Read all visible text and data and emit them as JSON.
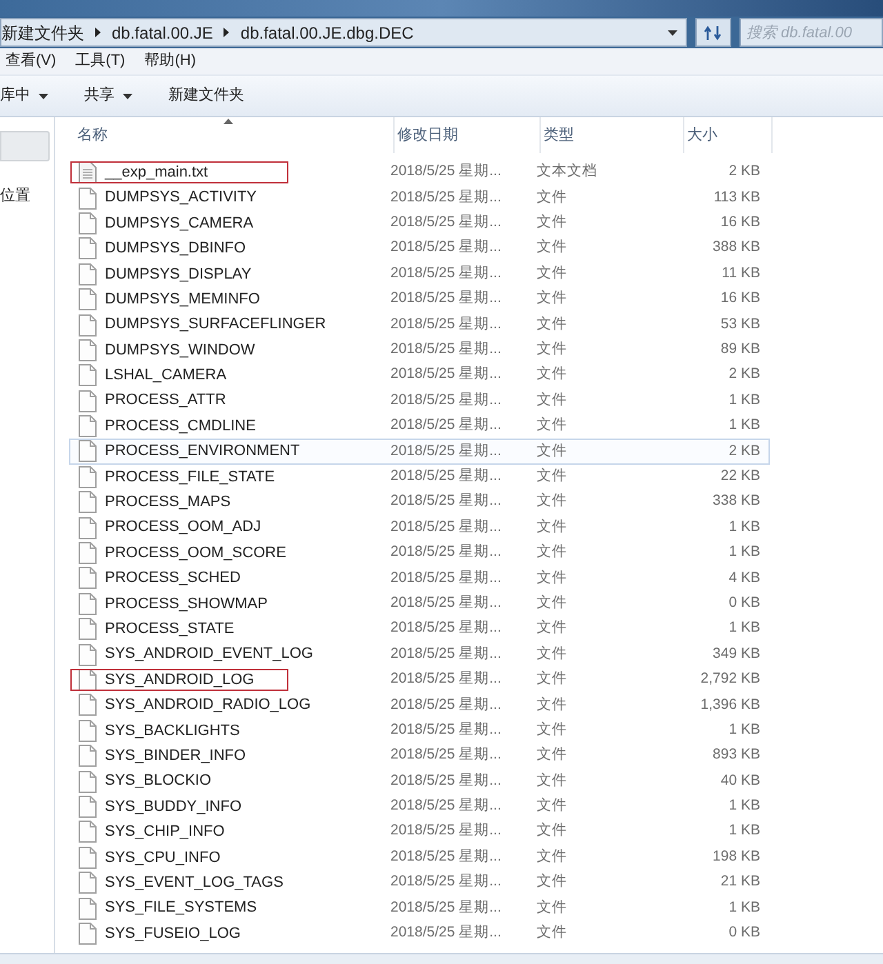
{
  "address_bar": {
    "crumbs": [
      "新建文件夹",
      "db.fatal.00.JE",
      "db.fatal.00.JE.dbg.DEC"
    ]
  },
  "search": {
    "placeholder": "搜索 db.fatal.00"
  },
  "menu": [
    "查看(V)",
    "工具(T)",
    "帮助(H)"
  ],
  "toolbar": [
    {
      "label": "库中",
      "dropdown": true
    },
    {
      "label": "共享",
      "dropdown": true
    },
    {
      "label": "新建文件夹",
      "dropdown": false
    }
  ],
  "nav_pane": {
    "items": [
      "位置"
    ]
  },
  "table": {
    "columns": [
      "名称",
      "修改日期",
      "类型",
      "大小"
    ],
    "rows": [
      {
        "name": "__exp_main.txt",
        "date": "2018/5/25 星期...",
        "type": "文本文档",
        "size": "2 KB",
        "kind": "text",
        "highlighted": true,
        "hovered": false
      },
      {
        "name": "DUMPSYS_ACTIVITY",
        "date": "2018/5/25 星期...",
        "type": "文件",
        "size": "113 KB",
        "kind": "file",
        "highlighted": false,
        "hovered": false
      },
      {
        "name": "DUMPSYS_CAMERA",
        "date": "2018/5/25 星期...",
        "type": "文件",
        "size": "16 KB",
        "kind": "file",
        "highlighted": false,
        "hovered": false
      },
      {
        "name": "DUMPSYS_DBINFO",
        "date": "2018/5/25 星期...",
        "type": "文件",
        "size": "388 KB",
        "kind": "file",
        "highlighted": false,
        "hovered": false
      },
      {
        "name": "DUMPSYS_DISPLAY",
        "date": "2018/5/25 星期...",
        "type": "文件",
        "size": "11 KB",
        "kind": "file",
        "highlighted": false,
        "hovered": false
      },
      {
        "name": "DUMPSYS_MEMINFO",
        "date": "2018/5/25 星期...",
        "type": "文件",
        "size": "16 KB",
        "kind": "file",
        "highlighted": false,
        "hovered": false
      },
      {
        "name": "DUMPSYS_SURFACEFLINGER",
        "date": "2018/5/25 星期...",
        "type": "文件",
        "size": "53 KB",
        "kind": "file",
        "highlighted": false,
        "hovered": false
      },
      {
        "name": "DUMPSYS_WINDOW",
        "date": "2018/5/25 星期...",
        "type": "文件",
        "size": "89 KB",
        "kind": "file",
        "highlighted": false,
        "hovered": false
      },
      {
        "name": "LSHAL_CAMERA",
        "date": "2018/5/25 星期...",
        "type": "文件",
        "size": "2 KB",
        "kind": "file",
        "highlighted": false,
        "hovered": false
      },
      {
        "name": "PROCESS_ATTR",
        "date": "2018/5/25 星期...",
        "type": "文件",
        "size": "1 KB",
        "kind": "file",
        "highlighted": false,
        "hovered": false
      },
      {
        "name": "PROCESS_CMDLINE",
        "date": "2018/5/25 星期...",
        "type": "文件",
        "size": "1 KB",
        "kind": "file",
        "highlighted": false,
        "hovered": false
      },
      {
        "name": "PROCESS_ENVIRONMENT",
        "date": "2018/5/25 星期...",
        "type": "文件",
        "size": "2 KB",
        "kind": "file",
        "highlighted": false,
        "hovered": true
      },
      {
        "name": "PROCESS_FILE_STATE",
        "date": "2018/5/25 星期...",
        "type": "文件",
        "size": "22 KB",
        "kind": "file",
        "highlighted": false,
        "hovered": false
      },
      {
        "name": "PROCESS_MAPS",
        "date": "2018/5/25 星期...",
        "type": "文件",
        "size": "338 KB",
        "kind": "file",
        "highlighted": false,
        "hovered": false
      },
      {
        "name": "PROCESS_OOM_ADJ",
        "date": "2018/5/25 星期...",
        "type": "文件",
        "size": "1 KB",
        "kind": "file",
        "highlighted": false,
        "hovered": false
      },
      {
        "name": "PROCESS_OOM_SCORE",
        "date": "2018/5/25 星期...",
        "type": "文件",
        "size": "1 KB",
        "kind": "file",
        "highlighted": false,
        "hovered": false
      },
      {
        "name": "PROCESS_SCHED",
        "date": "2018/5/25 星期...",
        "type": "文件",
        "size": "4 KB",
        "kind": "file",
        "highlighted": false,
        "hovered": false
      },
      {
        "name": "PROCESS_SHOWMAP",
        "date": "2018/5/25 星期...",
        "type": "文件",
        "size": "0 KB",
        "kind": "file",
        "highlighted": false,
        "hovered": false
      },
      {
        "name": "PROCESS_STATE",
        "date": "2018/5/25 星期...",
        "type": "文件",
        "size": "1 KB",
        "kind": "file",
        "highlighted": false,
        "hovered": false
      },
      {
        "name": "SYS_ANDROID_EVENT_LOG",
        "date": "2018/5/25 星期...",
        "type": "文件",
        "size": "349 KB",
        "kind": "file",
        "highlighted": false,
        "hovered": false
      },
      {
        "name": "SYS_ANDROID_LOG",
        "date": "2018/5/25 星期...",
        "type": "文件",
        "size": "2,792 KB",
        "kind": "file",
        "highlighted": true,
        "hovered": false
      },
      {
        "name": "SYS_ANDROID_RADIO_LOG",
        "date": "2018/5/25 星期...",
        "type": "文件",
        "size": "1,396 KB",
        "kind": "file",
        "highlighted": false,
        "hovered": false
      },
      {
        "name": "SYS_BACKLIGHTS",
        "date": "2018/5/25 星期...",
        "type": "文件",
        "size": "1 KB",
        "kind": "file",
        "highlighted": false,
        "hovered": false
      },
      {
        "name": "SYS_BINDER_INFO",
        "date": "2018/5/25 星期...",
        "type": "文件",
        "size": "893 KB",
        "kind": "file",
        "highlighted": false,
        "hovered": false
      },
      {
        "name": "SYS_BLOCKIO",
        "date": "2018/5/25 星期...",
        "type": "文件",
        "size": "40 KB",
        "kind": "file",
        "highlighted": false,
        "hovered": false
      },
      {
        "name": "SYS_BUDDY_INFO",
        "date": "2018/5/25 星期...",
        "type": "文件",
        "size": "1 KB",
        "kind": "file",
        "highlighted": false,
        "hovered": false
      },
      {
        "name": "SYS_CHIP_INFO",
        "date": "2018/5/25 星期...",
        "type": "文件",
        "size": "1 KB",
        "kind": "file",
        "highlighted": false,
        "hovered": false
      },
      {
        "name": "SYS_CPU_INFO",
        "date": "2018/5/25 星期...",
        "type": "文件",
        "size": "198 KB",
        "kind": "file",
        "highlighted": false,
        "hovered": false
      },
      {
        "name": "SYS_EVENT_LOG_TAGS",
        "date": "2018/5/25 星期...",
        "type": "文件",
        "size": "21 KB",
        "kind": "file",
        "highlighted": false,
        "hovered": false
      },
      {
        "name": "SYS_FILE_SYSTEMS",
        "date": "2018/5/25 星期...",
        "type": "文件",
        "size": "1 KB",
        "kind": "file",
        "highlighted": false,
        "hovered": false
      },
      {
        "name": "SYS_FUSEIO_LOG",
        "date": "2018/5/25 星期...",
        "type": "文件",
        "size": "0 KB",
        "kind": "file",
        "highlighted": false,
        "hovered": false
      }
    ]
  }
}
